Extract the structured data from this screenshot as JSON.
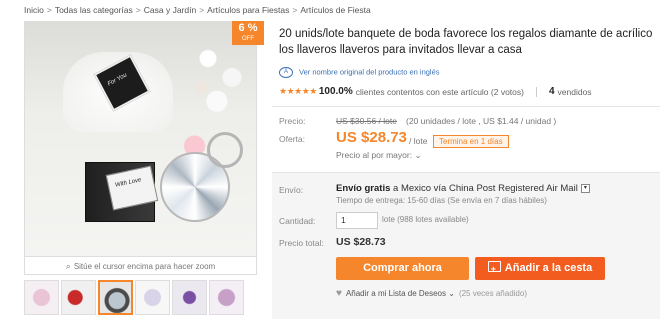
{
  "breadcrumb": [
    "Inicio",
    "Todas las categorías",
    "Casa y Jardín",
    "Artículos para Fiestas",
    "Artículos de Fiesta"
  ],
  "gallery": {
    "discount_pct": "6 %",
    "discount_off": "OFF",
    "tag_text": "For You",
    "box_text": "With Love",
    "zoom_hint": "Sitúe el cursor encima para hacer zoom",
    "thumbnail_count": 6,
    "active_thumbnail": 3
  },
  "product": {
    "title_line1": "20 unids/lote banquete de boda favorece los regalos diamante de acrílico",
    "title_line2": "los llaveros llaveros para invitados llevar a casa",
    "translate_link": "Ver nombre original del producto en inglés",
    "rating_stars": 5,
    "rating_pct": "100.0%",
    "rating_text": "clientes contentos con este artículo (2 votos)",
    "sold_count": "4",
    "sold_label": "vendidos"
  },
  "pricing": {
    "price_label": "Precio:",
    "original_price": "US $30.56 / lote",
    "original_detail": "(20 unidades / lote , US $1.44 / unidad )",
    "offer_label": "Oferta:",
    "offer_price": "US $28.73",
    "offer_unit": "/ lote",
    "ends_badge": "Termina en 1 días",
    "bulk_price": "Precio al por mayor:"
  },
  "shipping": {
    "label": "Envío:",
    "free": "Envío gratis",
    "destination": "a Mexico vía China Post Registered Air Mail",
    "delivery_time": "Tiempo de entrega: 15-60 días (Se envía en 7 días hábiles)"
  },
  "quantity": {
    "label": "Cantidad:",
    "value": "1",
    "unit_text": "lote (988 lotes available)"
  },
  "total": {
    "label": "Precio total:",
    "value": "US $28.73"
  },
  "actions": {
    "buy_now": "Comprar ahora",
    "add_to_cart": "Añadir a la cesta",
    "wishlist": "Añadir a mi Lista de Deseos",
    "wishlist_count": "(25 veces añadido)"
  },
  "colors": {
    "accent": "#f5862b",
    "cart": "#f25c1f",
    "link": "#3a6fb3"
  }
}
